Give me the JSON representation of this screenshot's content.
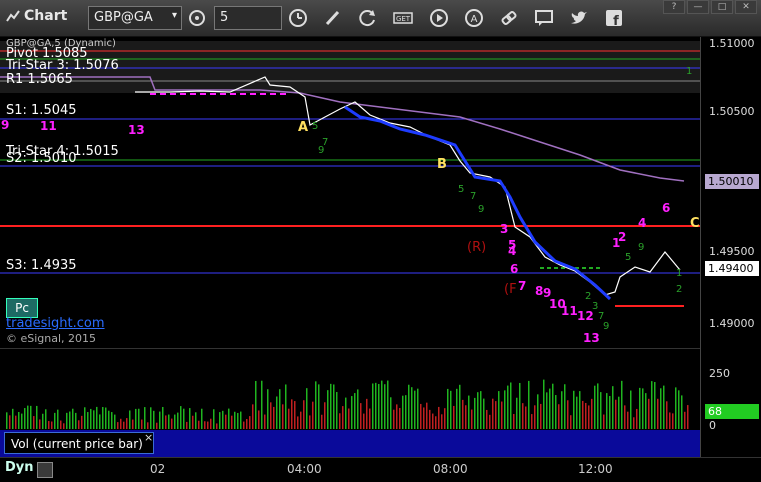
{
  "toolbar": {
    "title": "Chart",
    "symbol": "GBP@GA",
    "interval": "5",
    "window_buttons": [
      "?",
      "—",
      "□",
      "✕"
    ],
    "icons": [
      "cycle-icon",
      "clock-icon",
      "pen-icon",
      "refresh-icon",
      "get-icon",
      "play-icon",
      "alert-icon",
      "link-icon",
      "comment-icon",
      "twitter-icon",
      "facebook-icon"
    ]
  },
  "chart_header": {
    "study_caption": "GBP@GA,5 (Dynamic)"
  },
  "levels": [
    {
      "label": "Pivot 1.5085",
      "price": 1.5085,
      "color": "#ff3030"
    },
    {
      "label": "Tri-Star 3: 1.5076",
      "price": 1.5076,
      "color": "#22aa22"
    },
    {
      "label": "R1 1.5065",
      "price": 1.5065,
      "color": "#3b3bff"
    },
    {
      "label": "S1: 1.5045",
      "price": 1.5045,
      "color": "#3b3bff"
    },
    {
      "label": "Tri-Star 4: 1.5015",
      "price": 1.5015,
      "color": "#22aa22"
    },
    {
      "label": "S2: 1.5010",
      "price": 1.501,
      "color": "#3b3bff"
    },
    {
      "label": "S3: 1.4935",
      "price": 1.4935,
      "color": "#3b3bff"
    }
  ],
  "price_axis": {
    "ticks": [
      "1.51000",
      "1.50500",
      "1.49500",
      "1.49000"
    ],
    "flag_purple": "1.50010",
    "flag_last": "1.49400"
  },
  "markers": {
    "A": "A",
    "B": "B",
    "C": "C",
    "R": "(R)",
    "F": "(F"
  },
  "pc_button": "Pc",
  "website": "tradesight.com",
  "copyright": "© eSignal, 2015",
  "volume": {
    "legend": "Vol (current price bar)",
    "close": "×",
    "ticks": [
      "250",
      "0"
    ],
    "flag_value": "68"
  },
  "time_axis": {
    "dyn_label": "Dyn",
    "labels": [
      "02",
      "04:00",
      "08:00",
      "12:00"
    ]
  },
  "colors": {
    "price_up": "#ffffff",
    "price_down": "#1e3cff",
    "ma": "#a070c0",
    "counts_magenta": "#ff20ff",
    "counts_green": "#2aa02a",
    "vol_flag": "#22cc22"
  }
}
